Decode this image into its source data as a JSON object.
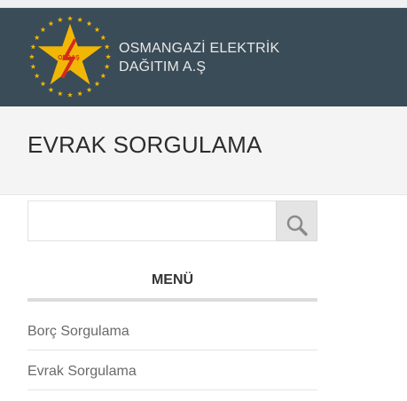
{
  "header": {
    "logo_text": "OEDAŞ",
    "brand_line1": "OSMANGAZİ ELEKTRİK",
    "brand_line2": "DAĞITIM A.Ş"
  },
  "page": {
    "title": "EVRAK SORGULAMA"
  },
  "search": {
    "value": "",
    "button_icon": "search-icon"
  },
  "menu": {
    "heading": "MENÜ",
    "items": [
      {
        "label": "Borç Sorgulama"
      },
      {
        "label": "Evrak Sorgulama"
      }
    ]
  },
  "colors": {
    "header_bg": "#3a4c58",
    "star": "#f2b705",
    "title_bg": "#f4f4f4"
  }
}
